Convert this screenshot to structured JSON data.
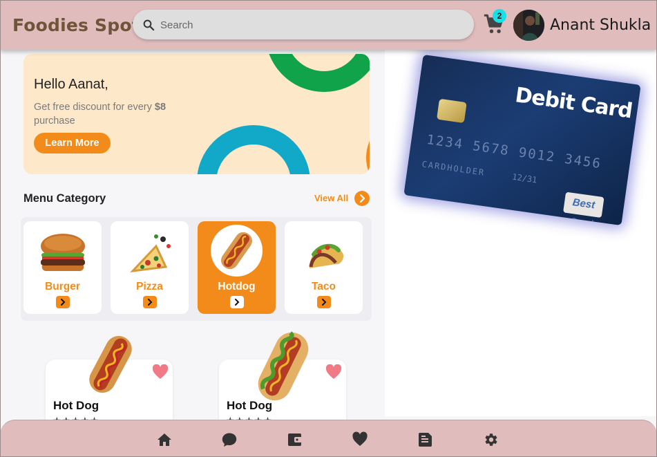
{
  "header": {
    "brand": "Foodies Spot",
    "search_placeholder": "Search",
    "cart_count": "2",
    "user_name": "Anant Shukla"
  },
  "hero": {
    "greeting": "Hello Aanat,",
    "subtitle_prefix": "Get free discount for every ",
    "subtitle_amount": "$8",
    "subtitle_suffix": " purchase",
    "button_label": "Learn More"
  },
  "menu": {
    "title": "Menu Category",
    "view_all": "View All",
    "categories": [
      {
        "label": "Burger",
        "active": false
      },
      {
        "label": "Pizza",
        "active": false
      },
      {
        "label": "Hotdog",
        "active": true
      },
      {
        "label": "Taco",
        "active": false
      }
    ]
  },
  "products": [
    {
      "name": "Hot Dog",
      "stars": "★★★★★",
      "favorite": true
    },
    {
      "name": "Hot Dog",
      "stars": "★★★★★",
      "favorite": true
    }
  ],
  "debit_card": {
    "title": "Debit Card",
    "number": "1234 5678 9012 3456",
    "holder": "CARDHOLDER",
    "expiry": "12/31",
    "logo": "Best Card"
  },
  "bottom_nav": {
    "icons": [
      "home-icon",
      "chat-icon",
      "wallet-icon",
      "heart-icon",
      "note-icon",
      "settings-icon"
    ]
  },
  "colors": {
    "accent": "#f28b1a",
    "header_bg": "#e0bcbc",
    "brand_text": "#6e5438",
    "hero_bg": "#fde9c9",
    "badge": "#19e0e6",
    "favorite": "#f07a86"
  }
}
